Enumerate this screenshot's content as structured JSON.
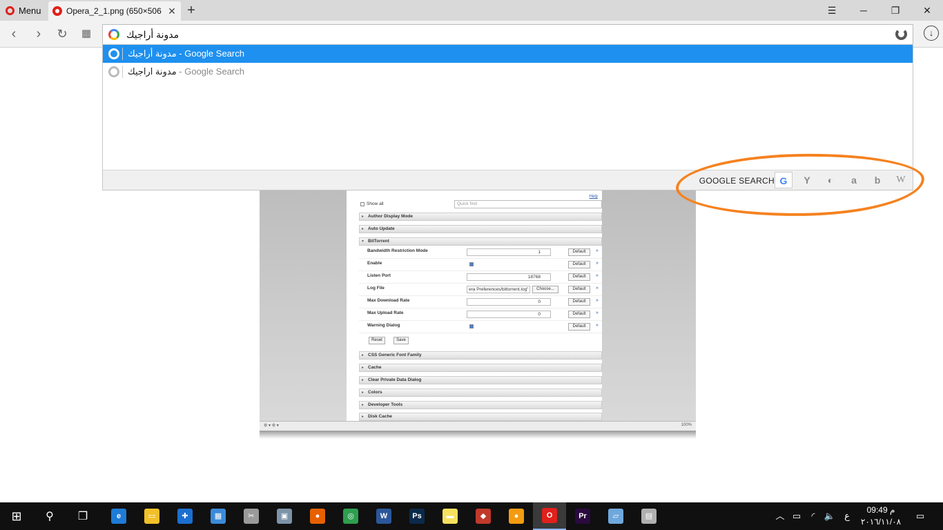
{
  "browser": {
    "menu_label": "Menu",
    "tab_title": "Opera_2_1.png (650×506)",
    "new_tab_label": "+",
    "address_value": "مدونة أراجيك"
  },
  "suggestions": [
    {
      "query": "مدونة أراجيك",
      "suffix": " - Google Search",
      "selected": true
    },
    {
      "query": "مدونة اراجيك",
      "suffix": " - Google Search",
      "selected": false
    }
  ],
  "search_engines": {
    "label": "GOOGLE SEARCH",
    "icons": [
      "google-icon",
      "yahoo-icon",
      "duckduckgo-icon",
      "amazon-icon",
      "bing-icon",
      "wikipedia-icon"
    ],
    "glyphs": [
      "G",
      "Y",
      "◐",
      "a",
      "b",
      "W"
    ]
  },
  "highlight_color": "#f58220",
  "settings_page": {
    "help_link": "Help",
    "show_all": "Show all",
    "quick_find_placeholder": "Quick find",
    "sections_before": [
      "Author Display Mode",
      "Auto Update"
    ],
    "open_section": "BitTorrent",
    "rows": [
      {
        "name": "Bandwidth Restriction Mode",
        "value": "1",
        "type": "number"
      },
      {
        "name": "Enable",
        "value": "",
        "type": "check"
      },
      {
        "name": "Listen Port",
        "value": "18768",
        "type": "number"
      },
      {
        "name": "Log File",
        "value": "era Preferences/bittorrent.log\"",
        "type": "file"
      },
      {
        "name": "Max Download Rate",
        "value": "0",
        "type": "number"
      },
      {
        "name": "Max Upload Rate",
        "value": "0",
        "type": "number"
      },
      {
        "name": "Warning Dialog",
        "value": "",
        "type": "check"
      }
    ],
    "default_label": "Default",
    "choose_label": "Choose...",
    "more_glyph": "»",
    "reset_label": "Reset",
    "save_label": "Save",
    "sections_after": [
      "CSS Generic Font Family",
      "Cache",
      "Clear Private Data Dialog",
      "Colors",
      "Developer Tools",
      "Disk Cache"
    ],
    "zoom": "100%"
  },
  "taskbar": {
    "apps": [
      {
        "name": "edge-icon",
        "glyph": "e",
        "color": "#1e7bd6"
      },
      {
        "name": "file-explorer-icon",
        "glyph": "▭",
        "color": "#f2c028"
      },
      {
        "name": "defender-icon",
        "glyph": "✚",
        "color": "#1b6fd0"
      },
      {
        "name": "control-panel-icon",
        "glyph": "▦",
        "color": "#3b8ad9"
      },
      {
        "name": "snipping-tool-icon",
        "glyph": "✂",
        "color": "#9a9a9a"
      },
      {
        "name": "photo-app-icon",
        "glyph": "▣",
        "color": "#7c93a8"
      },
      {
        "name": "firefox-icon",
        "glyph": "●",
        "color": "#e66000"
      },
      {
        "name": "chrome-icon",
        "glyph": "◎",
        "color": "#2e9e4f"
      },
      {
        "name": "word-icon",
        "glyph": "W",
        "color": "#2b579a"
      },
      {
        "name": "photoshop-icon",
        "glyph": "Ps",
        "color": "#0a2a4a"
      },
      {
        "name": "sticky-notes-icon",
        "glyph": "▬",
        "color": "#f6e05e"
      },
      {
        "name": "app-red-icon",
        "glyph": "◆",
        "color": "#c0392b"
      },
      {
        "name": "app-lock-icon",
        "glyph": "●",
        "color": "#f39c12"
      },
      {
        "name": "opera-icon",
        "glyph": "O",
        "color": "#e0201b"
      },
      {
        "name": "premiere-icon",
        "glyph": "Pr",
        "color": "#2a0a3f"
      },
      {
        "name": "notepad-icon",
        "glyph": "▱",
        "color": "#6fa8dc"
      },
      {
        "name": "media-app-icon",
        "glyph": "▤",
        "color": "#b0b0b0"
      }
    ],
    "lang": "ع",
    "time": "09:49 م",
    "date": "٢٠١٦/١١/٠٨"
  }
}
